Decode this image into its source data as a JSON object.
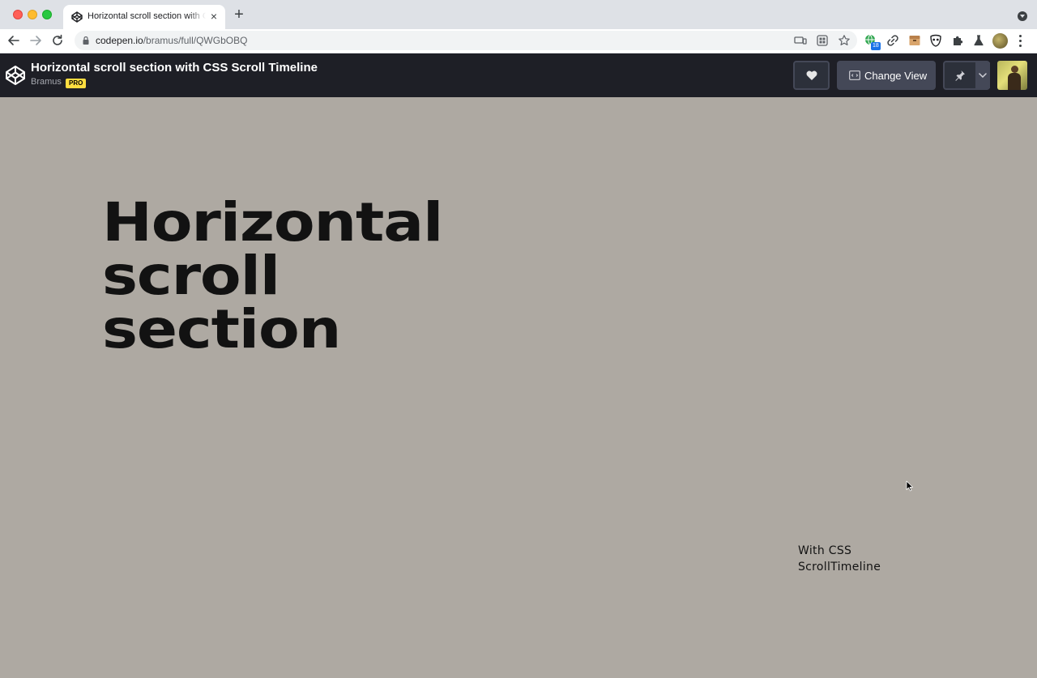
{
  "browser": {
    "tab_title": "Horizontal scroll section with CSS Scroll Timeline",
    "tab_close": "×",
    "new_tab": "+",
    "url_host": "codepen.io",
    "url_path": "/bramus/full/QWGbOBQ",
    "extension_badge": "18"
  },
  "codepen": {
    "pen_title": "Horizontal scroll section with CSS Scroll Timeline",
    "author": "Bramus",
    "pro_badge": "PRO",
    "change_view_label": "Change View"
  },
  "page": {
    "headline": [
      "Horizontal",
      "scroll",
      "section"
    ],
    "subline": [
      "With CSS",
      "ScrollTimeline"
    ]
  },
  "colors": {
    "page_background": "#aea9a2",
    "headline_text": "#121212",
    "codepen_header": "#1e1f26",
    "pro_badge": "#ffdd40"
  }
}
